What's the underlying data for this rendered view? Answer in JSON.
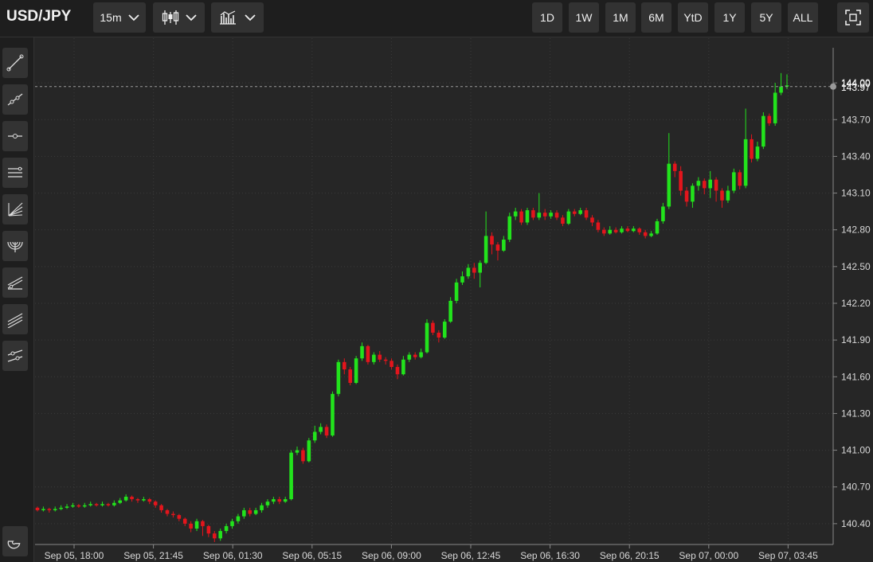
{
  "toolbar": {
    "symbol": "USD/JPY",
    "interval": "15m",
    "chart_type_icon": "candlestick-icon",
    "indicators_icon": "indicators-icon",
    "ranges": [
      "1D",
      "1W",
      "1M",
      "6M",
      "YtD",
      "1Y",
      "5Y",
      "ALL"
    ],
    "fullscreen_icon": "fullscreen-icon"
  },
  "tools": [
    "trend-line-icon",
    "ray-line-icon",
    "horizontal-line-icon",
    "parallel-channel-icon",
    "fan-icon",
    "arc-icon",
    "pitchfork-icon",
    "regression-channel-icon",
    "extended-line-icon"
  ],
  "magnet_icon": "magnet-icon",
  "colors": {
    "up": "#22e31c",
    "down": "#e3151c",
    "grid": "#3b3b3b",
    "background": "#262626"
  },
  "chart_data": {
    "type": "candlestick",
    "x_tick_labels": [
      "Sep 05, 18:00",
      "Sep 05, 21:45",
      "Sep 06, 01:30",
      "Sep 06, 05:15",
      "Sep 06, 09:00",
      "Sep 06, 12:45",
      "Sep 06, 16:30",
      "Sep 06, 20:15",
      "Sep 07, 00:00",
      "Sep 07, 03:45"
    ],
    "y_tick_labels": [
      "140.40",
      "140.70",
      "141.00",
      "141.30",
      "141.60",
      "141.90",
      "142.20",
      "142.50",
      "142.80",
      "143.10",
      "143.40",
      "143.70",
      "144.00"
    ],
    "ylim": [
      140.23,
      144.3
    ],
    "current_price_labels": [
      "144.00",
      "143.97"
    ],
    "current_price": 143.97,
    "candles": [
      [
        140.53,
        140.51,
        140.54,
        140.5
      ],
      [
        140.51,
        140.52,
        140.54,
        140.5
      ],
      [
        140.52,
        140.51,
        140.53,
        140.49
      ],
      [
        140.51,
        140.52,
        140.54,
        140.5
      ],
      [
        140.52,
        140.53,
        140.55,
        140.51
      ],
      [
        140.53,
        140.54,
        140.56,
        140.52
      ],
      [
        140.54,
        140.55,
        140.57,
        140.53
      ],
      [
        140.55,
        140.54,
        140.56,
        140.53
      ],
      [
        140.54,
        140.55,
        140.57,
        140.53
      ],
      [
        140.55,
        140.56,
        140.58,
        140.54
      ],
      [
        140.56,
        140.55,
        140.57,
        140.54
      ],
      [
        140.55,
        140.56,
        140.58,
        140.54
      ],
      [
        140.56,
        140.55,
        140.57,
        140.54
      ],
      [
        140.55,
        140.57,
        140.59,
        140.54
      ],
      [
        140.57,
        140.59,
        140.61,
        140.56
      ],
      [
        140.59,
        140.62,
        140.64,
        140.58
      ],
      [
        140.62,
        140.6,
        140.63,
        140.58
      ],
      [
        140.6,
        140.59,
        140.61,
        140.57
      ],
      [
        140.59,
        140.6,
        140.62,
        140.58
      ],
      [
        140.6,
        140.58,
        140.61,
        140.56
      ],
      [
        140.58,
        140.55,
        140.59,
        140.53
      ],
      [
        140.55,
        140.51,
        140.56,
        140.49
      ],
      [
        140.51,
        140.48,
        140.52,
        140.46
      ],
      [
        140.48,
        140.47,
        140.5,
        140.45
      ],
      [
        140.47,
        140.44,
        140.48,
        140.42
      ],
      [
        140.44,
        140.4,
        140.45,
        140.38
      ],
      [
        140.4,
        140.36,
        140.42,
        140.33
      ],
      [
        140.36,
        140.42,
        140.44,
        140.34
      ],
      [
        140.42,
        140.38,
        140.43,
        140.3
      ],
      [
        140.38,
        140.32,
        140.39,
        140.29
      ],
      [
        140.32,
        140.28,
        140.34,
        140.25
      ],
      [
        140.28,
        140.34,
        140.36,
        140.26
      ],
      [
        140.34,
        140.38,
        140.4,
        140.32
      ],
      [
        140.38,
        140.42,
        140.44,
        140.36
      ],
      [
        140.42,
        140.46,
        140.48,
        140.4
      ],
      [
        140.46,
        140.51,
        140.53,
        140.44
      ],
      [
        140.51,
        140.48,
        140.53,
        140.46
      ],
      [
        140.48,
        140.51,
        140.53,
        140.47
      ],
      [
        140.51,
        140.55,
        140.57,
        140.49
      ],
      [
        140.55,
        140.58,
        140.6,
        140.53
      ],
      [
        140.58,
        140.6,
        140.62,
        140.56
      ],
      [
        140.6,
        140.58,
        140.62,
        140.56
      ],
      [
        140.58,
        140.6,
        140.62,
        140.57
      ],
      [
        140.6,
        140.98,
        141.0,
        140.59
      ],
      [
        140.98,
        141.0,
        141.03,
        140.96
      ],
      [
        141.0,
        140.91,
        141.02,
        140.89
      ],
      [
        140.91,
        141.08,
        141.1,
        140.9
      ],
      [
        141.08,
        141.15,
        141.2,
        141.06
      ],
      [
        141.15,
        141.19,
        141.22,
        141.13
      ],
      [
        141.19,
        141.12,
        141.21,
        141.1
      ],
      [
        141.12,
        141.46,
        141.48,
        141.11
      ],
      [
        141.46,
        141.72,
        141.74,
        141.44
      ],
      [
        141.72,
        141.66,
        141.75,
        141.62
      ],
      [
        141.66,
        141.55,
        141.68,
        141.53
      ],
      [
        141.55,
        141.75,
        141.77,
        141.54
      ],
      [
        141.75,
        141.85,
        141.88,
        141.73
      ],
      [
        141.85,
        141.72,
        141.86,
        141.7
      ],
      [
        141.72,
        141.78,
        141.8,
        141.7
      ],
      [
        141.78,
        141.74,
        141.81,
        141.72
      ],
      [
        141.74,
        141.73,
        141.76,
        141.7
      ],
      [
        141.73,
        141.68,
        141.75,
        141.66
      ],
      [
        141.68,
        141.62,
        141.7,
        141.58
      ],
      [
        141.62,
        141.74,
        141.77,
        141.61
      ],
      [
        141.74,
        141.78,
        141.8,
        141.72
      ],
      [
        141.78,
        141.76,
        141.8,
        141.74
      ],
      [
        141.76,
        141.8,
        141.83,
        141.75
      ],
      [
        141.8,
        142.04,
        142.07,
        141.79
      ],
      [
        142.04,
        141.96,
        142.06,
        141.94
      ],
      [
        141.96,
        141.92,
        141.98,
        141.88
      ],
      [
        141.92,
        142.05,
        142.07,
        141.91
      ],
      [
        142.05,
        142.22,
        142.25,
        142.04
      ],
      [
        142.22,
        142.37,
        142.4,
        142.2
      ],
      [
        142.37,
        142.42,
        142.46,
        142.35
      ],
      [
        142.42,
        142.49,
        142.52,
        142.4
      ],
      [
        142.49,
        142.45,
        142.53,
        142.4
      ],
      [
        142.45,
        142.53,
        142.55,
        142.33
      ],
      [
        142.53,
        142.75,
        142.95,
        142.52
      ],
      [
        142.75,
        142.68,
        142.78,
        142.6
      ],
      [
        142.68,
        142.63,
        142.7,
        142.55
      ],
      [
        142.63,
        142.72,
        142.75,
        142.62
      ],
      [
        142.72,
        142.91,
        142.94,
        142.7
      ],
      [
        142.91,
        142.95,
        142.98,
        142.88
      ],
      [
        142.95,
        142.86,
        142.97,
        142.84
      ],
      [
        142.86,
        142.96,
        142.98,
        142.84
      ],
      [
        142.96,
        142.9,
        142.98,
        142.88
      ],
      [
        142.9,
        142.94,
        143.1,
        142.88
      ],
      [
        142.94,
        142.91,
        142.97,
        142.88
      ],
      [
        142.91,
        142.94,
        142.96,
        142.89
      ],
      [
        142.94,
        142.9,
        142.96,
        142.88
      ],
      [
        142.9,
        142.85,
        142.92,
        142.83
      ],
      [
        142.85,
        142.95,
        142.97,
        142.84
      ],
      [
        142.95,
        142.93,
        142.97,
        142.91
      ],
      [
        142.93,
        142.96,
        142.98,
        142.92
      ],
      [
        142.96,
        142.9,
        142.98,
        142.88
      ],
      [
        142.9,
        142.86,
        142.92,
        142.83
      ],
      [
        142.86,
        142.8,
        142.88,
        142.78
      ],
      [
        142.8,
        142.77,
        142.82,
        142.75
      ],
      [
        142.77,
        142.8,
        142.83,
        142.76
      ],
      [
        142.8,
        142.78,
        142.82,
        142.77
      ],
      [
        142.78,
        142.81,
        142.83,
        142.77
      ],
      [
        142.81,
        142.79,
        142.83,
        142.78
      ],
      [
        142.79,
        142.81,
        142.83,
        142.78
      ],
      [
        142.81,
        142.78,
        142.82,
        142.76
      ],
      [
        142.78,
        142.75,
        142.8,
        142.73
      ],
      [
        142.75,
        142.77,
        142.79,
        142.74
      ],
      [
        142.77,
        142.87,
        142.89,
        142.76
      ],
      [
        142.87,
        142.99,
        143.02,
        142.85
      ],
      [
        142.99,
        143.34,
        143.59,
        142.97
      ],
      [
        143.34,
        143.28,
        143.36,
        143.23
      ],
      [
        143.28,
        143.12,
        143.32,
        143.08
      ],
      [
        143.12,
        143.03,
        143.15,
        142.99
      ],
      [
        143.03,
        143.16,
        143.18,
        142.98
      ],
      [
        143.16,
        143.2,
        143.23,
        143.12
      ],
      [
        143.2,
        143.14,
        143.22,
        143.09
      ],
      [
        143.14,
        143.21,
        143.28,
        143.06
      ],
      [
        143.21,
        143.12,
        143.23,
        143.03
      ],
      [
        143.12,
        143.04,
        143.14,
        142.98
      ],
      [
        143.04,
        143.12,
        143.16,
        143.02
      ],
      [
        143.12,
        143.27,
        143.3,
        143.1
      ],
      [
        143.27,
        143.16,
        143.29,
        143.13
      ],
      [
        143.16,
        143.54,
        143.79,
        143.14
      ],
      [
        143.54,
        143.38,
        143.58,
        143.35
      ],
      [
        143.38,
        143.48,
        143.52,
        143.36
      ],
      [
        143.48,
        143.73,
        143.76,
        143.46
      ],
      [
        143.73,
        143.67,
        143.75,
        143.65
      ],
      [
        143.67,
        143.92,
        144.0,
        143.65
      ],
      [
        143.92,
        143.97,
        144.08,
        143.9
      ],
      [
        143.97,
        143.98,
        144.07,
        143.95
      ]
    ]
  }
}
